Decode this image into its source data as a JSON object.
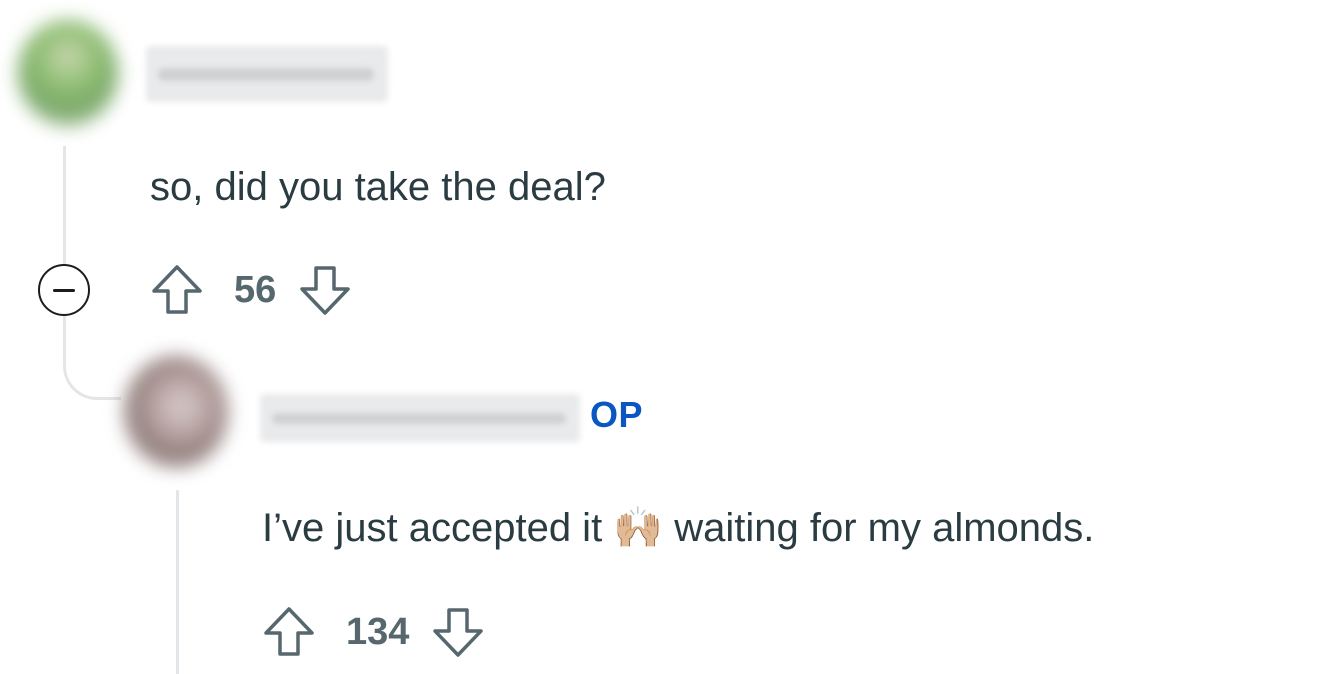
{
  "comments": [
    {
      "username": "",
      "text": "so, did you take the deal?",
      "score": "56",
      "collapse_icon": "minus-circle-icon",
      "upvote_icon": "arrow-up-icon",
      "downvote_icon": "arrow-down-icon"
    },
    {
      "username": "",
      "badge": "OP",
      "text_before": "I’ve just accepted it",
      "emoji": "🙌🏼",
      "text_after": "waiting for my almonds.",
      "score": "134",
      "upvote_icon": "arrow-up-icon",
      "downvote_icon": "arrow-down-icon"
    }
  ],
  "colors": {
    "text": "#2a3c42",
    "vote_count": "#56676e",
    "op_badge": "#0a56c2",
    "thread_line": "#e3e6e8"
  }
}
